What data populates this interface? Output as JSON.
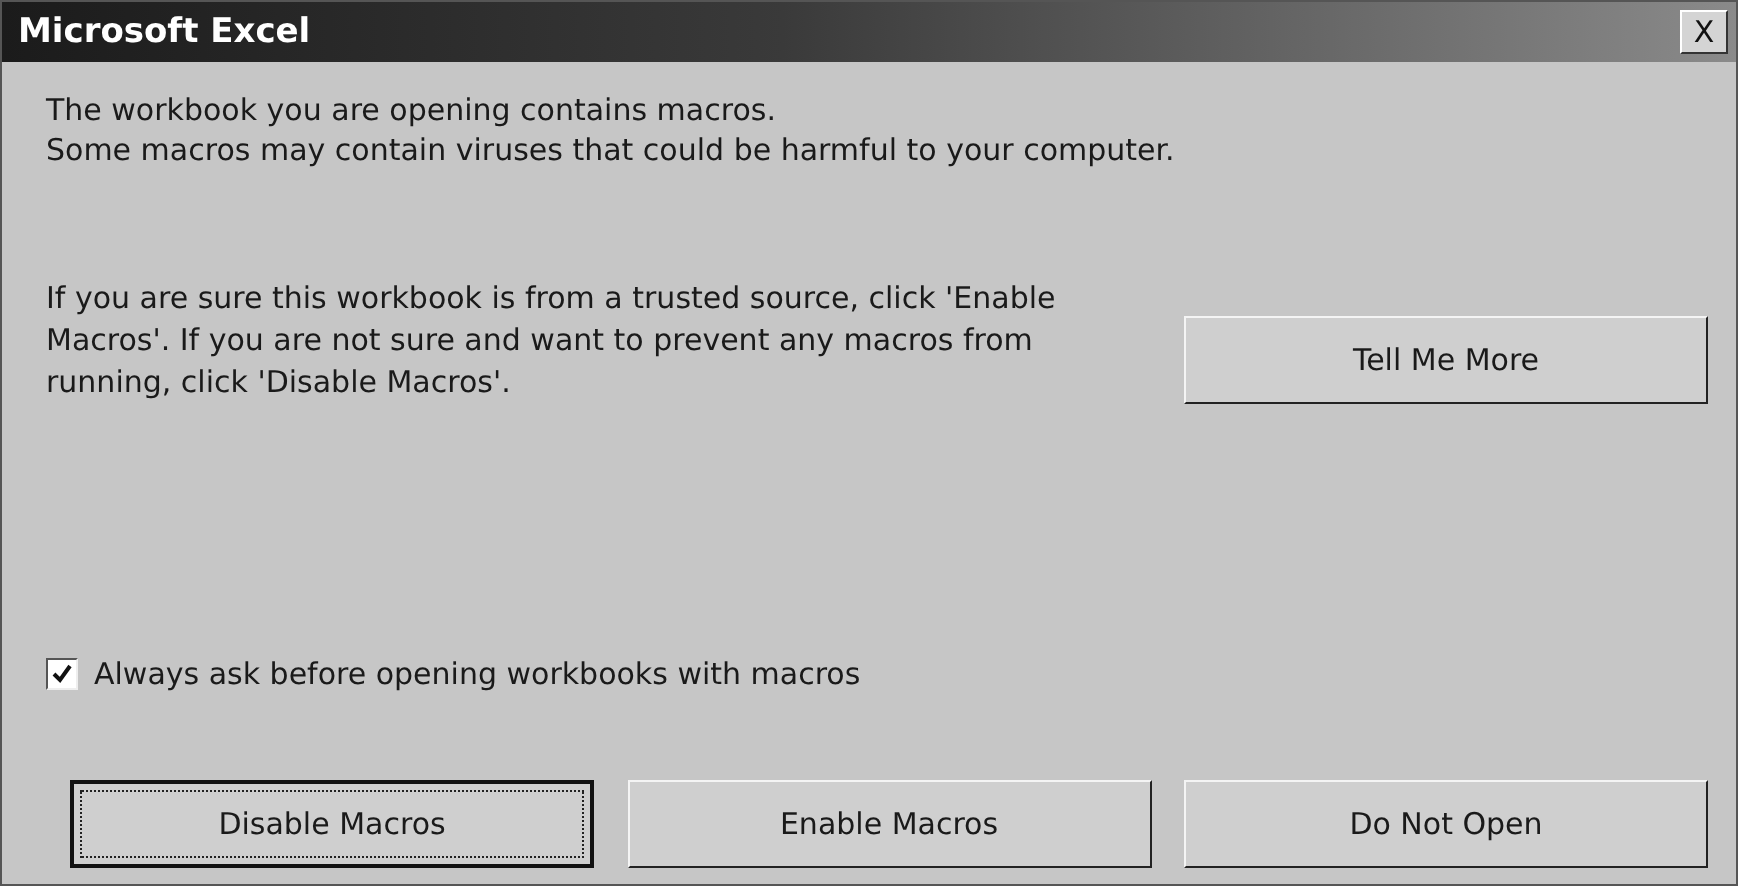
{
  "window": {
    "title": "Microsoft Excel",
    "close": "X"
  },
  "message": [
    "The workbook you are opening contains macros.",
    "Some macros may contain viruses that could be harmful to your computer."
  ],
  "advice": "If you are sure this workbook is from a trusted source, click 'Enable Macros'. If you are not sure and want to prevent any macros from running, click 'Disable Macros'.",
  "more_button": {
    "label": "Tell Me More",
    "default": false
  },
  "checkbox": {
    "label": "Always ask before opening workbooks with macros",
    "checked": true
  },
  "buttons": [
    {
      "label": "Disable Macros",
      "default": true
    },
    {
      "label": "Enable Macros",
      "default": false
    },
    {
      "label": "Do Not Open",
      "default": false
    }
  ]
}
